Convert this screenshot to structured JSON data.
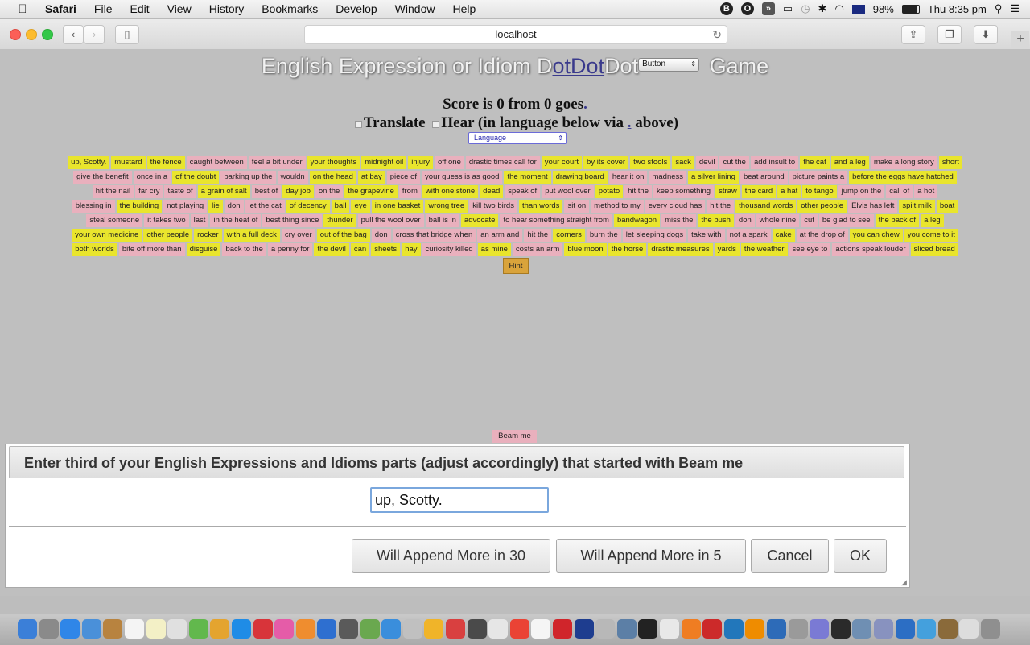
{
  "menubar": {
    "app": "Safari",
    "items": [
      "File",
      "Edit",
      "View",
      "History",
      "Bookmarks",
      "Develop",
      "Window",
      "Help"
    ],
    "battery": "98%",
    "clock": "Thu 8:35 pm"
  },
  "browser": {
    "url": "localhost"
  },
  "page": {
    "title_prefix": "English Expression or Idiom D",
    "title_dot1": "o",
    "title_dot2": "tDot",
    "title_mid": "Dot",
    "title_select": "Button",
    "title_suffix": "Game",
    "score_text": "Score is 0 from 0 goes",
    "score_dot": ".",
    "translate_label": "Translate",
    "hear_label": "Hear (in language below via",
    "hear_dot": ".",
    "hear_suffix": "above)",
    "language_select": "Language",
    "hint_label": "Hint",
    "beam_label": "Beam me"
  },
  "tiles": [
    [
      [
        "up, Scotty.",
        "y"
      ],
      [
        "mustard",
        "y"
      ],
      [
        "the fence",
        "y"
      ],
      [
        "caught between",
        "p"
      ],
      [
        "feel a bit under",
        "p"
      ],
      [
        "your thoughts",
        "y"
      ],
      [
        "midnight oil",
        "y"
      ],
      [
        "injury",
        "y"
      ],
      [
        "off one",
        "p"
      ],
      [
        "drastic times call for",
        "p"
      ],
      [
        "your court",
        "y"
      ],
      [
        "by its cover",
        "y"
      ],
      [
        "two stools",
        "y"
      ],
      [
        "sack",
        "y"
      ],
      [
        "devil",
        "p"
      ],
      [
        "cut the",
        "p"
      ],
      [
        "add insult to",
        "p"
      ],
      [
        "the cat",
        "y"
      ],
      [
        "and a leg",
        "y"
      ],
      [
        "make a long story",
        "p"
      ],
      [
        "short",
        "y"
      ]
    ],
    [
      [
        "give the benefit",
        "p"
      ],
      [
        "once in a",
        "p"
      ],
      [
        "of the doubt",
        "y"
      ],
      [
        "barking up the",
        "p"
      ],
      [
        "wouldn",
        "p"
      ],
      [
        "on the head",
        "y"
      ],
      [
        "at bay",
        "y"
      ],
      [
        "piece of",
        "p"
      ],
      [
        "your guess is as good",
        "p"
      ],
      [
        "the moment",
        "y"
      ],
      [
        "drawing board",
        "y"
      ],
      [
        "hear it on",
        "p"
      ],
      [
        "madness",
        "p"
      ],
      [
        "a silver lining",
        "y"
      ],
      [
        "beat around",
        "p"
      ],
      [
        "picture paints a",
        "p"
      ],
      [
        "before the eggs have hatched",
        "y"
      ]
    ],
    [
      [
        "hit the nail",
        "p"
      ],
      [
        "far cry",
        "p"
      ],
      [
        "taste of",
        "p"
      ],
      [
        "a grain of salt",
        "y"
      ],
      [
        "best of",
        "p"
      ],
      [
        "day job",
        "y"
      ],
      [
        "on the",
        "p"
      ],
      [
        "the grapevine",
        "y"
      ],
      [
        "from",
        "p"
      ],
      [
        "with one stone",
        "y"
      ],
      [
        "dead",
        "y"
      ],
      [
        "speak of",
        "p"
      ],
      [
        "put wool over",
        "p"
      ],
      [
        "potato",
        "y"
      ],
      [
        "hit the",
        "p"
      ],
      [
        "keep something",
        "p"
      ],
      [
        "straw",
        "y"
      ],
      [
        "the card",
        "y"
      ],
      [
        "a hat",
        "y"
      ],
      [
        "to tango",
        "y"
      ],
      [
        "jump on the",
        "p"
      ],
      [
        "call of",
        "p"
      ],
      [
        "a hot",
        "p"
      ]
    ],
    [
      [
        "blessing in",
        "p"
      ],
      [
        "the building",
        "y"
      ],
      [
        "not playing",
        "p"
      ],
      [
        "lie",
        "y"
      ],
      [
        "don",
        "p"
      ],
      [
        "let the cat",
        "p"
      ],
      [
        "of decency",
        "y"
      ],
      [
        "ball",
        "y"
      ],
      [
        "eye",
        "y"
      ],
      [
        "in one basket",
        "y"
      ],
      [
        "wrong tree",
        "y"
      ],
      [
        "kill two birds",
        "p"
      ],
      [
        "than words",
        "y"
      ],
      [
        "sit on",
        "p"
      ],
      [
        "method to my",
        "p"
      ],
      [
        "every cloud has",
        "p"
      ],
      [
        "hit the",
        "p"
      ],
      [
        "thousand words",
        "y"
      ],
      [
        "other people",
        "y"
      ],
      [
        "Elvis has left",
        "p"
      ],
      [
        "spilt milk",
        "y"
      ],
      [
        "boat",
        "y"
      ]
    ],
    [
      [
        "steal someone",
        "p"
      ],
      [
        "it takes two",
        "p"
      ],
      [
        "last",
        "p"
      ],
      [
        "in the heat of",
        "p"
      ],
      [
        "best thing since",
        "p"
      ],
      [
        "thunder",
        "y"
      ],
      [
        "pull the wool over",
        "p"
      ],
      [
        "ball is in",
        "p"
      ],
      [
        "advocate",
        "y"
      ],
      [
        "to hear something straight from",
        "p"
      ],
      [
        "bandwagon",
        "y"
      ],
      [
        "miss the",
        "p"
      ],
      [
        "the bush",
        "y"
      ],
      [
        "don",
        "p"
      ],
      [
        "whole nine",
        "p"
      ],
      [
        "cut",
        "p"
      ],
      [
        "be glad to see",
        "p"
      ],
      [
        "the back of",
        "y"
      ],
      [
        "a leg",
        "y"
      ]
    ],
    [
      [
        "your own medicine",
        "y"
      ],
      [
        "other people",
        "y"
      ],
      [
        "rocker",
        "y"
      ],
      [
        "with a full deck",
        "y"
      ],
      [
        "cry over",
        "p"
      ],
      [
        "out of the bag",
        "y"
      ],
      [
        "don",
        "p"
      ],
      [
        "cross that bridge when",
        "p"
      ],
      [
        "an arm and",
        "p"
      ],
      [
        "hit the",
        "p"
      ],
      [
        "corners",
        "y"
      ],
      [
        "burn the",
        "p"
      ],
      [
        "let sleeping dogs",
        "p"
      ],
      [
        "take with",
        "p"
      ],
      [
        "not a spark",
        "p"
      ],
      [
        "cake",
        "y"
      ],
      [
        "at the drop of",
        "p"
      ],
      [
        "you can chew",
        "y"
      ],
      [
        "you come to it",
        "y"
      ]
    ],
    [
      [
        "both worlds",
        "y"
      ],
      [
        "bite off more than",
        "p"
      ],
      [
        "disguise",
        "y"
      ],
      [
        "back to the",
        "p"
      ],
      [
        "a penny for",
        "p"
      ],
      [
        "the devil",
        "y"
      ],
      [
        "can",
        "y"
      ],
      [
        "sheets",
        "y"
      ],
      [
        "hay",
        "y"
      ],
      [
        "curiosity killed",
        "p"
      ],
      [
        "as mine",
        "y"
      ],
      [
        "costs an arm",
        "p"
      ],
      [
        "blue moon",
        "y"
      ],
      [
        "the horse",
        "y"
      ],
      [
        "drastic measures",
        "y"
      ],
      [
        "yards",
        "y"
      ],
      [
        "the weather",
        "y"
      ],
      [
        "see eye to",
        "p"
      ],
      [
        "actions speak louder",
        "p"
      ],
      [
        "sliced bread",
        "y"
      ]
    ]
  ],
  "dialog": {
    "heading": "Enter third of your English Expressions and Idioms parts (adjust accordingly) that started with Beam me",
    "input_value": "up, Scotty.",
    "btn_append30": "Will Append More in 30",
    "btn_append5": "Will Append More in 5",
    "btn_cancel": "Cancel",
    "btn_ok": "OK"
  }
}
